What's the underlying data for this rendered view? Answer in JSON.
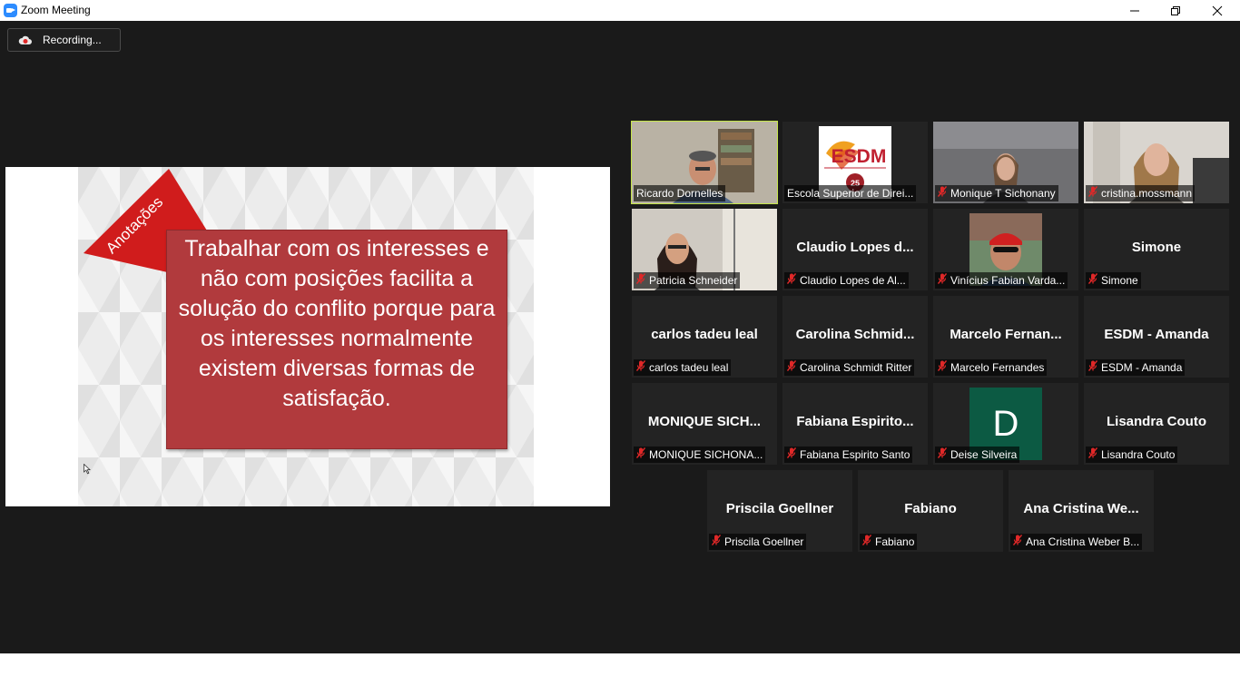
{
  "window": {
    "title": "Zoom Meeting"
  },
  "recording": {
    "label": "Recording..."
  },
  "slide": {
    "flag_label": "Anotações",
    "text": "Trabalhar com os interesses e não com posições facilita a solução do conflito porque para os interesses normalmente existem diversas formas de satisfação."
  },
  "participants": [
    {
      "name": "Ricardo Dornelles",
      "display": "",
      "muted": false,
      "kind": "video",
      "active": true
    },
    {
      "name": "Escola Superior de Direi...",
      "display": "",
      "muted": false,
      "kind": "logo",
      "logo_text": "ESDM",
      "logo_badge": "25"
    },
    {
      "name": "Monique T Sichonany",
      "display": "",
      "muted": true,
      "kind": "video"
    },
    {
      "name": "cristina.mossmann",
      "display": "",
      "muted": true,
      "kind": "video"
    },
    {
      "name": "Patricia Schneider",
      "display": "",
      "muted": true,
      "kind": "video"
    },
    {
      "name": "Claudio Lopes de Al...",
      "display": "Claudio Lopes d...",
      "muted": true,
      "kind": "name"
    },
    {
      "name": "Vinícius Fabian Varda...",
      "display": "",
      "muted": true,
      "kind": "video"
    },
    {
      "name": "Simone",
      "display": "Simone",
      "muted": true,
      "kind": "name"
    },
    {
      "name": "carlos tadeu leal",
      "display": "carlos tadeu leal",
      "muted": true,
      "kind": "name"
    },
    {
      "name": "Carolina Schmidt Ritter",
      "display": "Carolina Schmid...",
      "muted": true,
      "kind": "name"
    },
    {
      "name": "Marcelo Fernandes",
      "display": "Marcelo Fernan...",
      "muted": true,
      "kind": "name"
    },
    {
      "name": "ESDM - Amanda",
      "display": "ESDM - Amanda",
      "muted": true,
      "kind": "name"
    },
    {
      "name": "MONIQUE SICHONA...",
      "display": "MONIQUE SICH...",
      "muted": true,
      "kind": "name"
    },
    {
      "name": "Fabiana Espirito Santo",
      "display": "Fabiana Espirito...",
      "muted": true,
      "kind": "name"
    },
    {
      "name": "Deise Silveira",
      "display": "",
      "muted": true,
      "kind": "avatar",
      "avatar_letter": "D"
    },
    {
      "name": "Lisandra Couto",
      "display": "Lisandra Couto",
      "muted": true,
      "kind": "name"
    },
    {
      "name": "Priscila Goellner",
      "display": "Priscila Goellner",
      "muted": true,
      "kind": "name"
    },
    {
      "name": "Fabiano",
      "display": "Fabiano",
      "muted": true,
      "kind": "name"
    },
    {
      "name": "Ana Cristina Weber B...",
      "display": "Ana Cristina We...",
      "muted": true,
      "kind": "name"
    }
  ],
  "colors": {
    "background": "#1a1a1a",
    "tile": "#232323",
    "active_speaker": "#c6e64a",
    "muted_mic": "#e02828",
    "slide_box": "#b13a3d",
    "zoom_blue": "#2d8cff"
  }
}
